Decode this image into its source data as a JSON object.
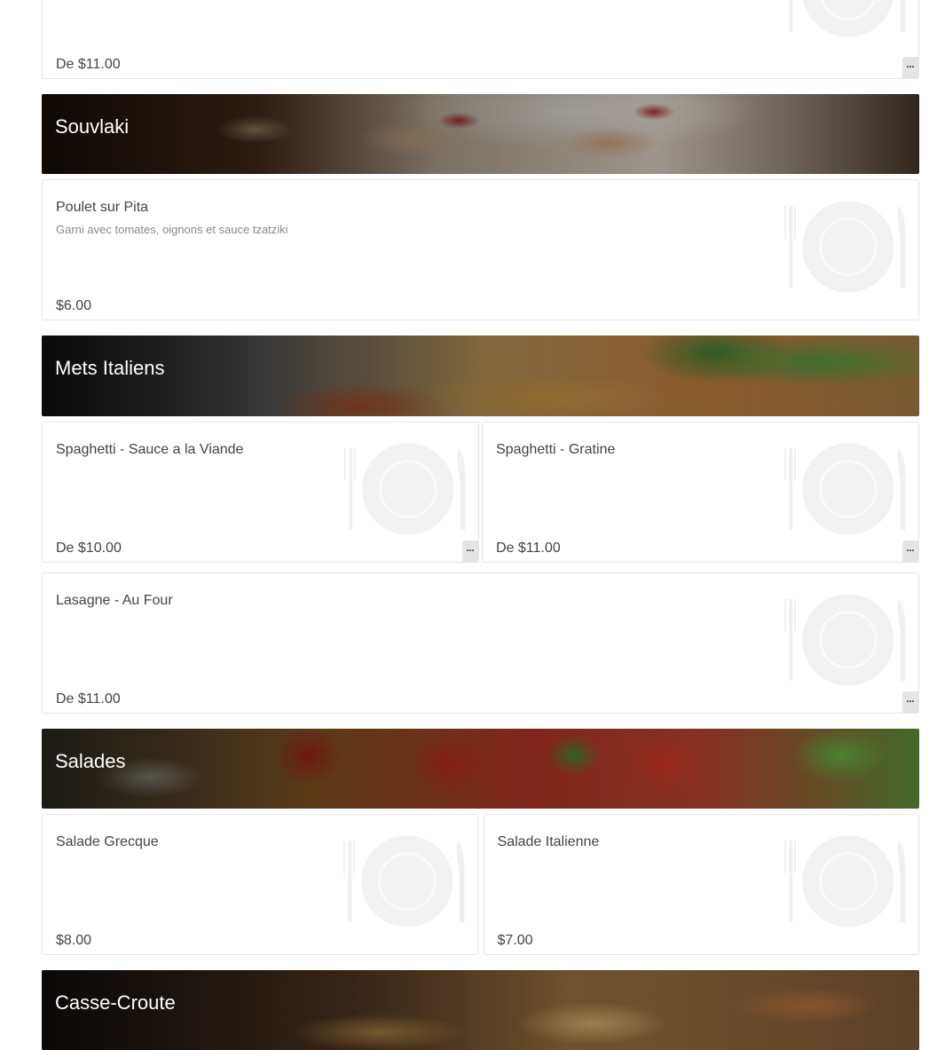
{
  "top_item": {
    "price": "De $11.00",
    "more": "..."
  },
  "sections": [
    {
      "name": "Souvlaki",
      "items": [
        {
          "title": "Poulet sur Pita",
          "desc": "Garni avec tomates, oignons et sauce tzatziki",
          "price": "$6.00"
        }
      ]
    },
    {
      "name": "Mets Italiens",
      "items": [
        {
          "title": "Spaghetti - Sauce a la Viande",
          "price": "De $10.00",
          "more": "..."
        },
        {
          "title": "Spaghetti - Gratine",
          "price": "De $11.00",
          "more": "..."
        },
        {
          "title": "Lasagne - Au Four",
          "price": "De $11.00",
          "more": "..."
        }
      ]
    },
    {
      "name": "Salades",
      "items": [
        {
          "title": "Salade Grecque",
          "price": "$8.00"
        },
        {
          "title": "Salade Italienne",
          "price": "$7.00"
        }
      ]
    },
    {
      "name": "Casse-Croute",
      "items": []
    }
  ]
}
